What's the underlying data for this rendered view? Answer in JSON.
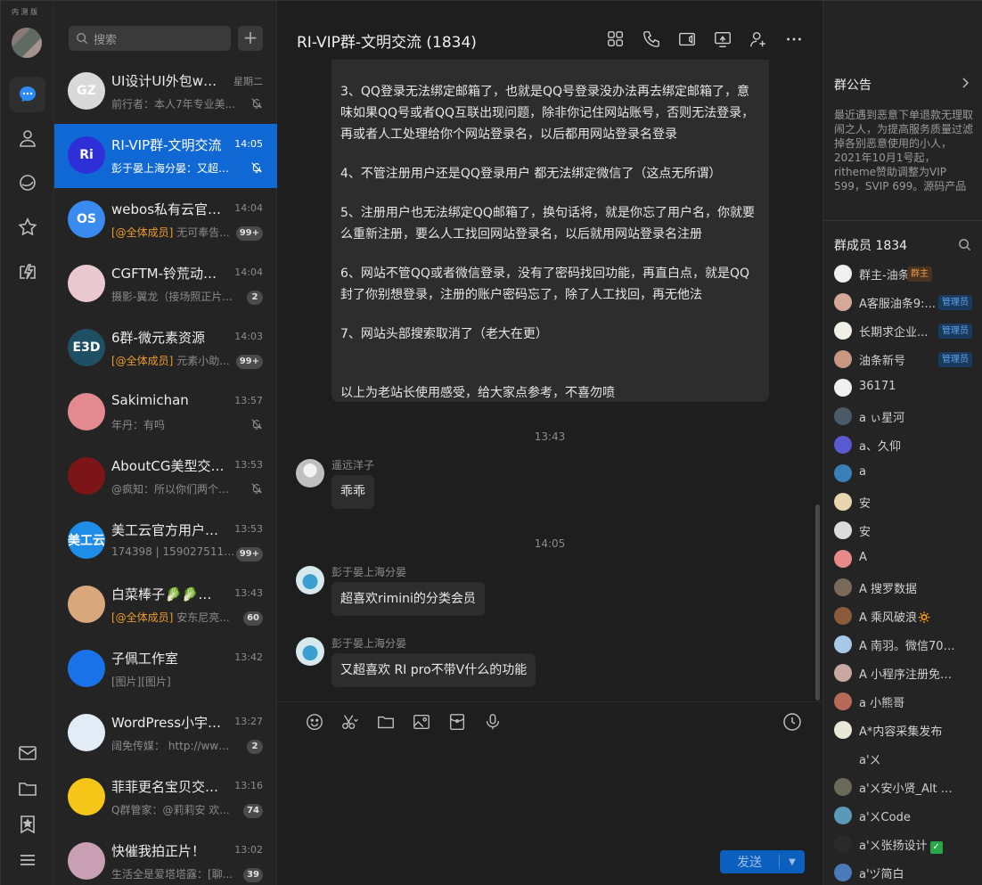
{
  "app": {
    "edition": "内 测 版"
  },
  "sidebar": {
    "items": [
      {
        "name": "messages",
        "icon": "chat-bubble-icon",
        "active": true
      },
      {
        "name": "contacts",
        "icon": "person-icon"
      },
      {
        "name": "channels",
        "icon": "planet-icon"
      },
      {
        "name": "favorites",
        "icon": "star-icon"
      },
      {
        "name": "apps",
        "icon": "lightning-box-icon"
      }
    ],
    "bottom": [
      {
        "name": "mail",
        "icon": "mail-icon"
      },
      {
        "name": "files",
        "icon": "folder-icon"
      },
      {
        "name": "collections",
        "icon": "bookmark-star-icon"
      },
      {
        "name": "menu",
        "icon": "hamburger-icon"
      }
    ]
  },
  "search": {
    "placeholder": "搜索"
  },
  "sessions": [
    {
      "name": "UI设计UI外包www...",
      "time": "星期二",
      "preview_prefix": "",
      "preview": "前行者：本人7年专业美...",
      "badge": "",
      "muted": true,
      "avatar_color": "#d9d9d9",
      "avatar_text": "GZ"
    },
    {
      "name": "RI-VIP群-文明交流",
      "time": "14:05",
      "preview_prefix": "",
      "preview": "彭于晏上海分晏：又超喜...",
      "badge": "",
      "muted": true,
      "avatar_color": "#2f2fd8",
      "avatar_text": "Ri",
      "selected": true
    },
    {
      "name": "webos私有云官方...",
      "time": "14:04",
      "preview_prefix": "[@全体成员]",
      "preview": " 无可奉告...",
      "badge": "99+",
      "muted": false,
      "avatar_color": "#3a8bf0",
      "avatar_text": "OS"
    },
    {
      "name": "CGFTM-铃荒动漫...",
      "time": "14:04",
      "preview_prefix": "",
      "preview": "摄影-翼龙（接场照正片...",
      "badge": "2",
      "muted": false,
      "avatar_color": "#e9c9cf",
      "avatar_text": ""
    },
    {
      "name": "6群-微元素资源",
      "time": "14:03",
      "preview_prefix": "[@全体成员]",
      "preview": " 元素小助...",
      "badge": "99+",
      "muted": false,
      "avatar_color": "#1f4f63",
      "avatar_text": "E3D"
    },
    {
      "name": "Sakimichan",
      "time": "13:57",
      "preview_prefix": "",
      "preview": "年丹：有吗",
      "badge": "",
      "muted": true,
      "avatar_color": "#e28a8f",
      "avatar_text": ""
    },
    {
      "name": "AboutCG美型交流...",
      "time": "13:53",
      "preview_prefix": "",
      "preview": "@疯知：所以你们两个先...",
      "badge": "",
      "muted": true,
      "avatar_color": "#7b1518",
      "avatar_text": ""
    },
    {
      "name": "美工云官方用户反...",
      "time": "13:53",
      "preview_prefix": "",
      "preview": "174398 | 1590275110...",
      "badge": "99+",
      "muted": false,
      "avatar_color": "#1e8de8",
      "avatar_text": "美工云"
    },
    {
      "name": "白菜棒子🥬🥬🥬...",
      "time": "13:43",
      "preview_prefix": "[@全体成员]",
      "preview": " 安东尼亮...",
      "badge": "60",
      "muted": false,
      "avatar_color": "#d8a77b",
      "avatar_text": ""
    },
    {
      "name": "子佩工作室",
      "time": "13:42",
      "preview_prefix": "",
      "preview": "[图片][图片]",
      "badge": "",
      "muted": false,
      "avatar_color": "#1a72e8",
      "avatar_text": ""
    },
    {
      "name": "WordPress小宇宙...",
      "time": "13:27",
      "preview_prefix": "",
      "preview": "阔免传媒： http://www.j...",
      "badge": "2",
      "muted": false,
      "avatar_color": "#e2ecf7",
      "avatar_text": ""
    },
    {
      "name": "菲菲更名宝贝交流群",
      "time": "13:16",
      "preview_prefix": "",
      "preview": "Q群管家：@莉莉安 欢...",
      "badge": "74",
      "muted": false,
      "avatar_color": "#f5c518",
      "avatar_text": ""
    },
    {
      "name": "快催我拍正片！",
      "time": "13:02",
      "preview_prefix": "",
      "preview": "生活全是爱塔塔露：[聊...",
      "badge": "39",
      "muted": false,
      "avatar_color": "#c99fb4",
      "avatar_text": ""
    }
  ],
  "chat": {
    "title": "RI-VIP群-文明交流 (1834)",
    "toolbar": [
      "apps-grid-icon",
      "phone-icon",
      "video-icon",
      "screen-share-icon",
      "add-member-icon",
      "more-icon"
    ],
    "notice_paragraphs": [
      "3、QQ登录无法绑定邮箱了，也就是QQ号登录没办法再去绑定邮箱了，意味如果QQ号或者QQ互联出现问题，除非你记住网站账号，否则无法登录，再或者人工处理给你个网站登录名，以后都用网站登录名登录",
      "4、不管注册用户还是QQ登录用户 都无法绑定微信了（这点无所谓）",
      "5、注册用户也无法绑定QQ邮箱了，换句话将，就是你忘了用户名，你就要么重新注册，要么人工找回网站登录名，以后就用网站登录名注册",
      "6、网站不管QQ或者微信登录，没有了密码找回功能，再直白点，就是QQ封了你别想登录，注册的账户密码忘了，除了人工找回，再无他法",
      "7、网站头部搜索取消了（老大在更）",
      "以上为老站长使用感受，给大家点参考，不喜勿喷"
    ],
    "time1": "13:43",
    "time2": "14:05",
    "messages": [
      {
        "sender": "遥远洋子",
        "text": "乖乖"
      },
      {
        "sender": "彭于晏上海分晏",
        "text": "超喜欢rimini的分类会员"
      },
      {
        "sender": "彭于晏上海分晏",
        "text": "又超喜欢  RI pro不带V什么的功能"
      }
    ],
    "input_tools": [
      "emoji-icon",
      "scissors-icon",
      "folder-icon",
      "image-icon",
      "red-packet-icon",
      "microphone-icon"
    ],
    "send_label": "发送"
  },
  "panel": {
    "announcement_title": "群公告",
    "announcement_text": "最近遇到恶意下单退款无理取闹之人，为提高服务质量过滤掉各别恶意使用的小人，2021年10月1号起，ritheme赞助调整为VIP 599，SVIP 699。源码产品具有可复制...",
    "members_title": "群成员 1834",
    "members": [
      {
        "name": "群主-油条",
        "role": "群主",
        "role_type": "owner",
        "color": "#f0f0f0"
      },
      {
        "name": "A客服油条9:...",
        "role": "管理员",
        "role_type": "admin",
        "color": "#d4a99a"
      },
      {
        "name": "长期求企业...",
        "role": "管理员",
        "role_type": "admin",
        "color": "#f2efe6"
      },
      {
        "name": "油条新号",
        "role": "管理员",
        "role_type": "admin",
        "color": "#c99680"
      },
      {
        "name": "36171",
        "role": "",
        "role_type": "",
        "color": "#f0f0f0"
      },
      {
        "name": "a ぃ星河",
        "role": "",
        "role_type": "",
        "color": "#4a5a66"
      },
      {
        "name": "a、久仰",
        "role": "",
        "role_type": "",
        "color": "#5a5ad0"
      },
      {
        "name": "a",
        "role": "",
        "role_type": "",
        "color": "#3b7fb8"
      },
      {
        "name": "安",
        "role": "",
        "role_type": "",
        "color": "#e8d6b0"
      },
      {
        "name": "安",
        "role": "",
        "role_type": "",
        "color": "#dcdcdc"
      },
      {
        "name": "A",
        "role": "",
        "role_type": "",
        "color": "#e88a8a"
      },
      {
        "name": "A 搜罗数据",
        "role": "",
        "role_type": "",
        "color": "#7a6a5a"
      },
      {
        "name": "A 乘风破浪🔅",
        "role": "",
        "role_type": "",
        "color": "#8a5a3a"
      },
      {
        "name": "A 南羽。微信7000031",
        "role": "",
        "role_type": "",
        "color": "#a8c8e8"
      },
      {
        "name": "A 小程序注册免认证...",
        "role": "",
        "role_type": "",
        "color": "#c8a8a0"
      },
      {
        "name": "a 小熊哥",
        "role": "",
        "role_type": "",
        "color": "#b86a5a"
      },
      {
        "name": "A*内容采集发布",
        "role": "",
        "role_type": "",
        "color": "#e8e8d8"
      },
      {
        "name": "a'ㄨ",
        "role": "",
        "role_type": "",
        "color": "#242424"
      },
      {
        "name": "a'ㄨ安小贤_Alt 𝓥𝒾𝓹P",
        "role": "",
        "role_type": "",
        "color": "#6a6a5a"
      },
      {
        "name": "a'ㄨCode",
        "role": "",
        "role_type": "",
        "color": "#5a9ab8"
      },
      {
        "name": "a'ㄨ张扬设计",
        "role": "",
        "role_type": "",
        "check": true,
        "color": "#2a2a2a"
      },
      {
        "name": "a'ヅ简白",
        "role": "",
        "role_type": "",
        "color": "#4a7ab8"
      }
    ]
  }
}
